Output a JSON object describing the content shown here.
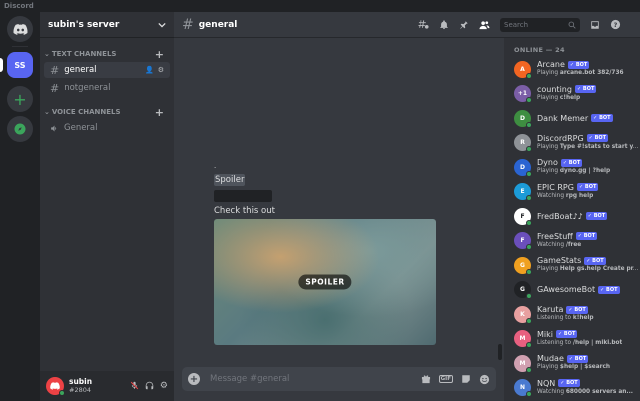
{
  "titlebar": {
    "title": "Discord"
  },
  "guilds": {
    "server_abbr": "SS",
    "add_symbol": "+"
  },
  "server": {
    "name": "subin's server"
  },
  "channels": {
    "text_category": "TEXT CHANNELS",
    "voice_category": "VOICE CHANNELS",
    "text": [
      {
        "name": "general",
        "active": true
      },
      {
        "name": "notgeneral",
        "active": false
      }
    ],
    "voice": [
      {
        "name": "General"
      }
    ]
  },
  "user": {
    "name": "subin",
    "tag": "#2804"
  },
  "header": {
    "channel": "general"
  },
  "search": {
    "placeholder": "Search"
  },
  "messages": {
    "dot": ".",
    "spoiler_text": "Spoiler",
    "text": "Check this out",
    "spoiler_badge": "SPOILER"
  },
  "composer": {
    "placeholder": "Message #general",
    "gif": "GIF"
  },
  "members": {
    "header": "ONLINE — 24",
    "bot_label": "✓ BOT",
    "list": [
      {
        "name": "Arcane",
        "activity_prefix": "Playing ",
        "activity": "arcane.bot 382/736",
        "color": "#f26522",
        "initial": "A"
      },
      {
        "name": "counting",
        "activity_prefix": "Playing ",
        "activity": "c!help",
        "color": "#7b5ea7",
        "initial": "+1"
      },
      {
        "name": "Dank Memer",
        "activity_prefix": "",
        "activity": "",
        "color": "#3e8e41",
        "initial": "D"
      },
      {
        "name": "DiscordRPG",
        "activity_prefix": "Playing ",
        "activity": "Type #!stats to start y...",
        "color": "#8e9297",
        "initial": "R"
      },
      {
        "name": "Dyno",
        "activity_prefix": "Playing ",
        "activity": "dyno.gg | ?help",
        "color": "#2a64d2",
        "initial": "D"
      },
      {
        "name": "EPIC RPG",
        "activity_prefix": "Watching ",
        "activity": "rpg help",
        "color": "#1c9bd8",
        "initial": "E"
      },
      {
        "name": "FredBoat♪♪",
        "activity_prefix": "",
        "activity": "",
        "color": "#ffffff",
        "initial": "F"
      },
      {
        "name": "FreeStuff",
        "activity_prefix": "Watching ",
        "activity": "/free",
        "color": "#6b4fbb",
        "initial": "F"
      },
      {
        "name": "GameStats",
        "activity_prefix": "Playing ",
        "activity": "Help gs.help Create pr...",
        "color": "#f0a020",
        "initial": "G"
      },
      {
        "name": "GAwesomeBot",
        "activity_prefix": "",
        "activity": "",
        "color": "#202225",
        "initial": "G"
      },
      {
        "name": "Karuta",
        "activity_prefix": "Listening to ",
        "activity": "k!help",
        "color": "#e8a0a0",
        "initial": "K"
      },
      {
        "name": "Miki",
        "activity_prefix": "Listening to ",
        "activity": "/help | miki.bot",
        "color": "#e86080",
        "initial": "M"
      },
      {
        "name": "Mudae",
        "activity_prefix": "Playing ",
        "activity": "$help | $search",
        "color": "#d0a0b0",
        "initial": "M"
      },
      {
        "name": "NQN",
        "activity_prefix": "Watching ",
        "activity": "680000 servers an...",
        "color": "#4a7ad0",
        "initial": "N"
      }
    ]
  }
}
